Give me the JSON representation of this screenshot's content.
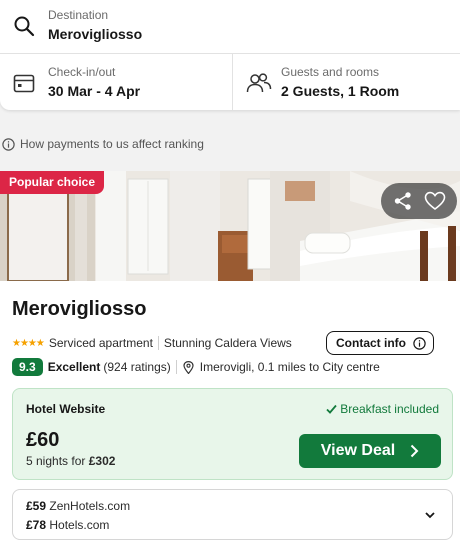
{
  "search": {
    "destination_caption": "Destination",
    "destination_value": "Merovigliosso",
    "dates_caption": "Check-in/out",
    "dates_value": "30 Mar - 4 Apr",
    "guests_caption": "Guests and rooms",
    "guests_value": "2 Guests, 1 Room"
  },
  "ranking_info": "How payments to us affect ranking",
  "hotel": {
    "badge": "Popular choice",
    "name": "Merovigliosso",
    "stars": 4,
    "type": "Serviced apartment",
    "feature": "Stunning Caldera Views",
    "contact_label": "Contact info",
    "score": "9.3",
    "rating_word": "Excellent",
    "rating_count": "(924 ratings)",
    "location": "Imerovigli, 0.1 miles to City centre"
  },
  "deal": {
    "provider": "Hotel Website",
    "perk": "Breakfast included",
    "price": "£60",
    "nights_prefix": "5 nights for",
    "total": "£302",
    "cta": "View Deal"
  },
  "other_deals": [
    {
      "price": "£59",
      "provider": "ZenHotels.com"
    },
    {
      "price": "£78",
      "provider": "Hotels.com"
    }
  ],
  "colors": {
    "badge": "#dc2646",
    "brand_green": "#127a3c",
    "deal_bg": "#e8f6ea",
    "star": "#f5a100"
  }
}
